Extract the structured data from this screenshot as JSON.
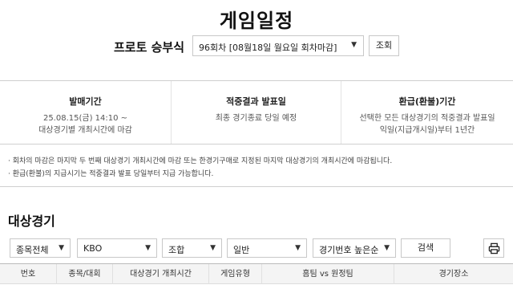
{
  "page_title": "게임일정",
  "round": {
    "label": "프로토 승부식",
    "selected": "96회차 [08월18일 월요일 회차마감]",
    "search_label": "조회"
  },
  "info": {
    "sale": {
      "title": "발매기간",
      "lines": [
        "25.08.15(금) 14:10 ~",
        "대상경기별 개최시간에 마감"
      ]
    },
    "result": {
      "title": "적중결과 발표일",
      "lines": [
        "최종 경기종료 당일 예정"
      ]
    },
    "refund": {
      "title": "환급(환불)기간",
      "lines": [
        "선택한 모든 대상경기의 적중결과 발표일",
        "익일(지급개시일)부터 1년간"
      ]
    }
  },
  "notices": {
    "n1": {
      "prefix": "· 회차의 마감은 마지막 두 번째 대상경기 개최시간에 마감 또는 한경기구매로 지정된 마지막 대상경기의 개최시간에 마감됩니다."
    },
    "n2": {
      "prefix": "· 환급(환불)의 지급시기는 적중결과 발표 당일부터 지급 가능합니다."
    }
  },
  "section_title": "대상경기",
  "filters": {
    "sport": "종목전체",
    "league": "KBO",
    "type": "조합",
    "kind": "일반",
    "sort": "경기번호 높은순",
    "search_label": "검색"
  },
  "table": {
    "headers": [
      "번호",
      "종목/대회",
      "대상경기 개최시간",
      "게임유형",
      "홈팀  vs  원정팀",
      "경기장소"
    ]
  },
  "colors": {
    "accent": "#1f5fc9",
    "border": "#c8c8c8",
    "header_bg": "#f4f4f4"
  }
}
